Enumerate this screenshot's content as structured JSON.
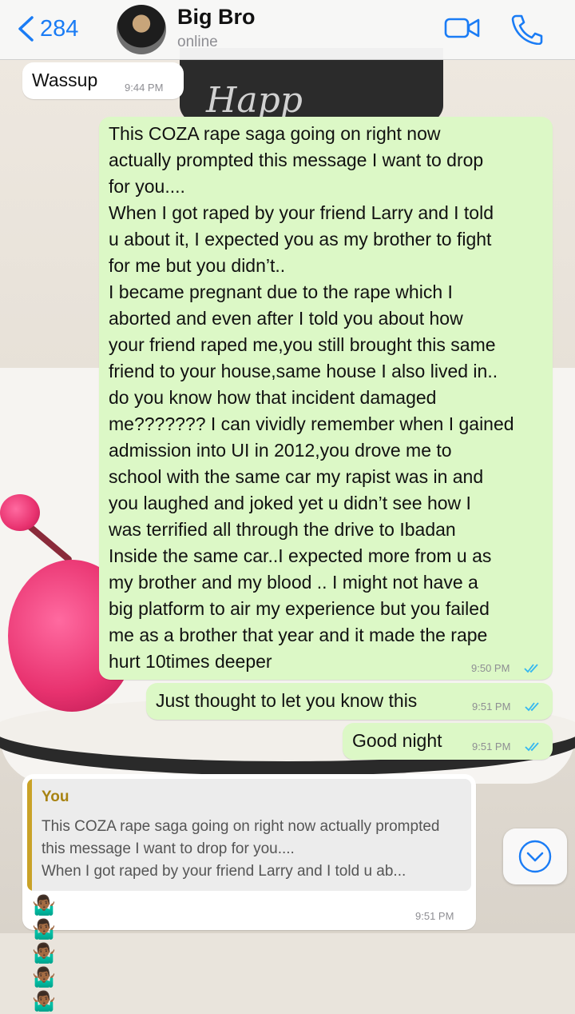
{
  "header": {
    "back_count": "284",
    "contact_name": "Big Bro",
    "status": "online"
  },
  "messages": [
    {
      "direction": "in",
      "text": "Wassup",
      "time": "9:44 PM"
    },
    {
      "direction": "out",
      "text": "This COZA rape saga going on right now\nactually prompted this message I want to drop\nfor you....\nWhen I got raped by your friend Larry and I told\nu about it, I expected you as my brother to fight\nfor me but you didn’t..\nI became pregnant due to the rape which I\naborted and even after I told you about how\nyour friend raped me,you still brought this same\nfriend to your house,same house I also lived in..\ndo you know how that incident damaged\nme??????? I can vividly remember when I gained\nadmission into UI in 2012,you drove me to\nschool with the same car my rapist was in and\nyou laughed and joked yet u didn’t see how I\nwas terrified all through the drive to Ibadan\nInside the same car..I expected more from u as\nmy brother and my blood .. I might not have a\nbig platform to air my experience but you failed\nme as a brother that year and it made the rape\nhurt 10times deeper",
      "time": "9:50 PM",
      "read": true
    },
    {
      "direction": "out",
      "text": "Just thought to let you know this",
      "time": "9:51 PM",
      "read": true
    },
    {
      "direction": "out",
      "text": "Good night",
      "time": "9:51 PM",
      "read": true
    }
  ],
  "reply": {
    "quote_author": "You",
    "quote_text": "This COZA rape saga going on right now actually prompted this message I want to drop for you....\nWhen I got raped by your friend Larry and I told u ab...",
    "emoji": "🤷🏾‍♂️🤷🏾‍♂️🤷🏾‍♂️🤷🏾‍♂️🤷🏾‍♂️",
    "time": "9:51 PM"
  },
  "colors": {
    "accent": "#1a7cf5",
    "outgoing_bubble": "#dcf8c6",
    "incoming_bubble": "#ffffff",
    "read_ticks": "#34b7f1",
    "quote_author": "#a88312"
  },
  "icons": [
    "chevron-left-icon",
    "video-call-icon",
    "phone-icon",
    "double-check-icon",
    "chevron-down-icon"
  ]
}
